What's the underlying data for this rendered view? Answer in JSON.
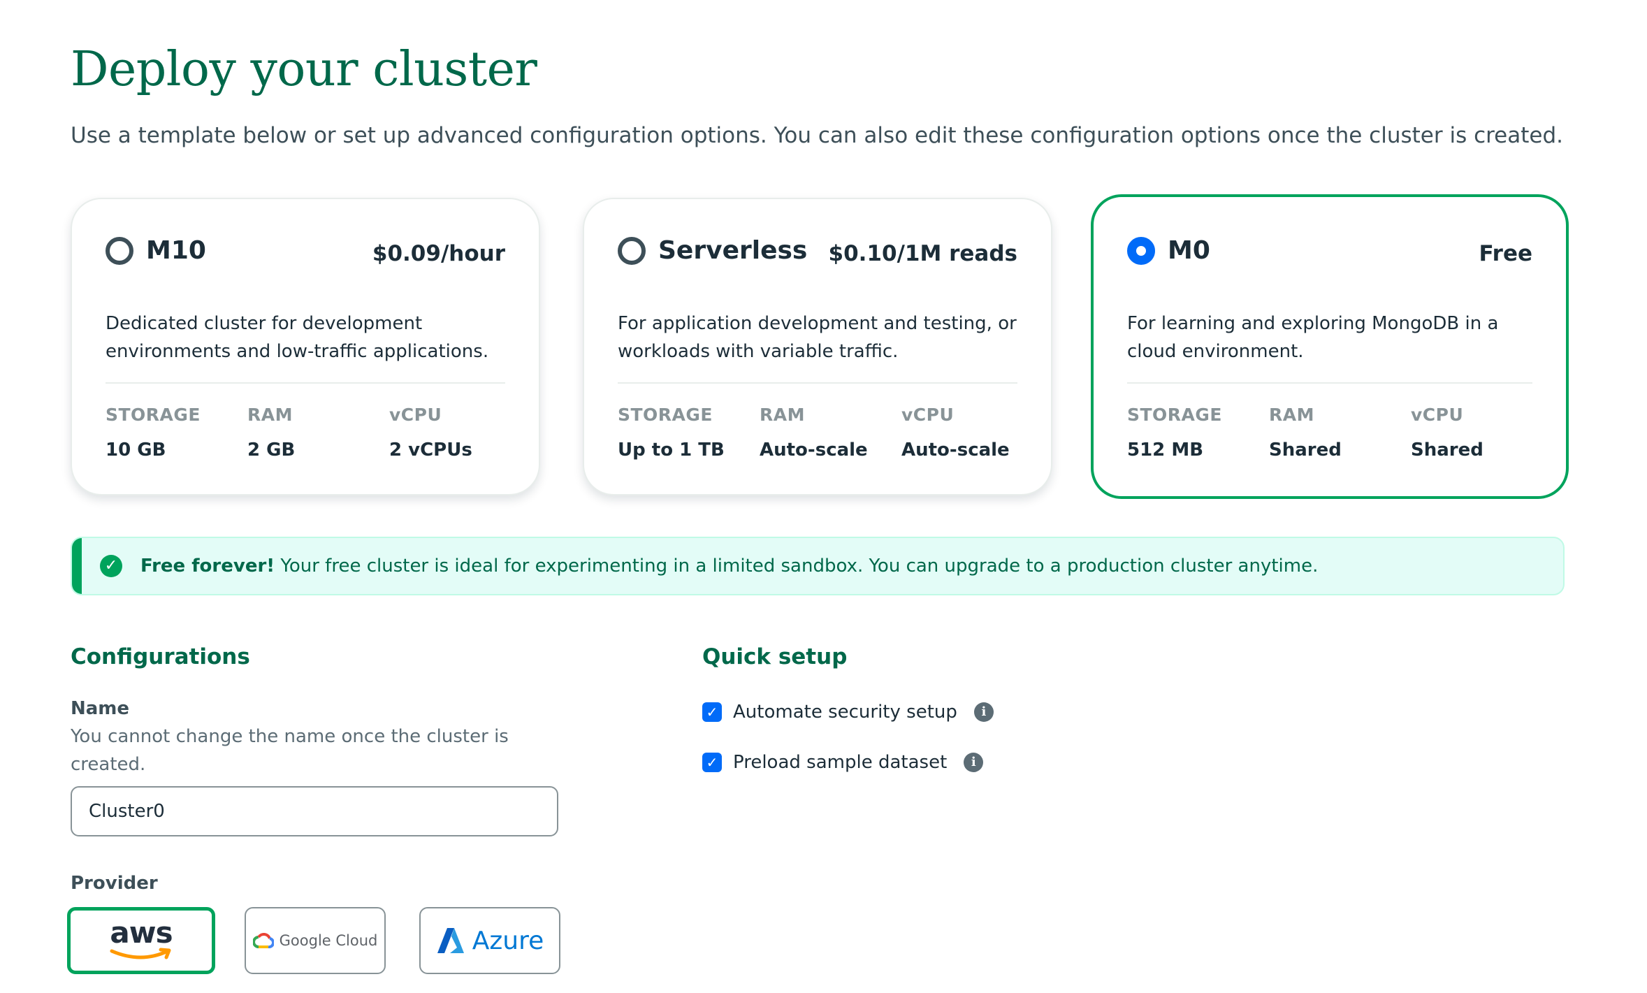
{
  "header": {
    "title": "Deploy your cluster",
    "subtitle": "Use a template below or set up advanced configuration options. You can also edit these configuration options once the cluster is created."
  },
  "tiers": [
    {
      "name": "M10",
      "price": "$0.09/hour",
      "selected": false,
      "description": "Dedicated cluster for development environments and low-traffic applications.",
      "specs": [
        {
          "label": "STORAGE",
          "value": "10 GB"
        },
        {
          "label": "RAM",
          "value": "2 GB"
        },
        {
          "label": "vCPU",
          "value": "2 vCPUs"
        }
      ]
    },
    {
      "name": "Serverless",
      "price": "$0.10/1M reads",
      "selected": false,
      "description": "For application development and testing, or workloads with variable traffic.",
      "specs": [
        {
          "label": "STORAGE",
          "value": "Up to 1 TB"
        },
        {
          "label": "RAM",
          "value": "Auto-scale"
        },
        {
          "label": "vCPU",
          "value": "Auto-scale"
        }
      ]
    },
    {
      "name": "M0",
      "price": "Free",
      "selected": true,
      "description": "For learning and exploring MongoDB in a cloud environment.",
      "specs": [
        {
          "label": "STORAGE",
          "value": "512 MB"
        },
        {
          "label": "RAM",
          "value": "Shared"
        },
        {
          "label": "vCPU",
          "value": "Shared"
        }
      ]
    }
  ],
  "banner": {
    "bold": "Free forever!",
    "text": " Your free cluster is ideal for experimenting in a limited sandbox. You can upgrade to a production cluster anytime."
  },
  "configurations": {
    "title": "Configurations",
    "name_label": "Name",
    "name_description": "You cannot change the name once the cluster is created.",
    "name_value": "Cluster0",
    "provider_label": "Provider",
    "providers": [
      {
        "name": "aws",
        "selected": true
      },
      {
        "name": "Google Cloud",
        "selected": false
      },
      {
        "name": "Azure",
        "selected": false
      }
    ]
  },
  "quick_setup": {
    "title": "Quick setup",
    "options": [
      {
        "label": "Automate security setup",
        "checked": true,
        "icon": "info-icon"
      },
      {
        "label": "Preload sample dataset",
        "checked": true,
        "icon": "info-icon"
      }
    ]
  },
  "colors": {
    "brand_green": "#00684a",
    "accent_green": "#00a35c",
    "radio_blue": "#016bf8",
    "banner_bg": "#e3fcf7"
  }
}
